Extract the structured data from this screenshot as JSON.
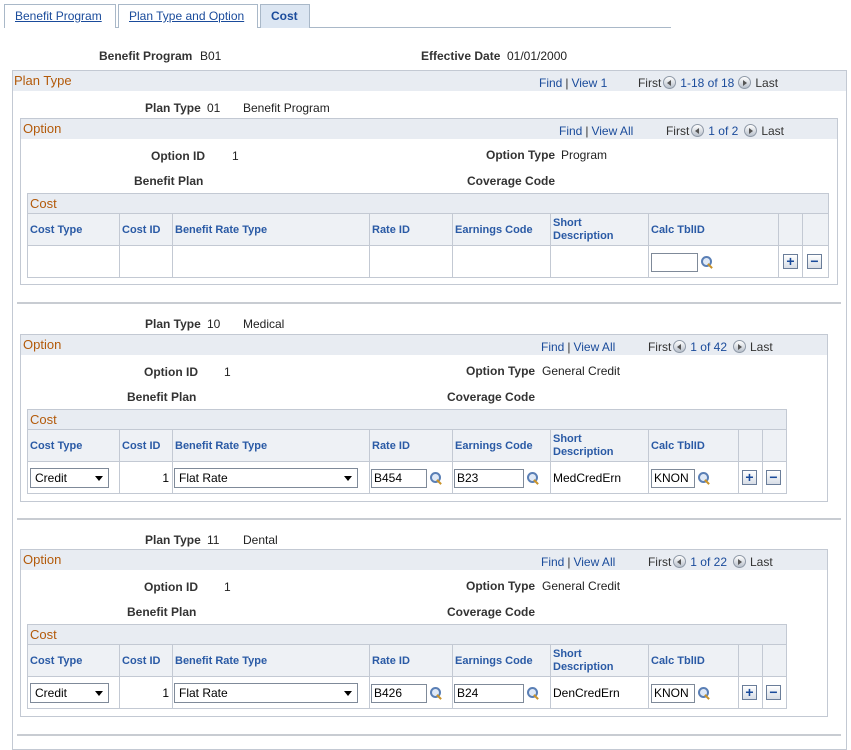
{
  "tabs": [
    {
      "label": "Benefit Program",
      "active": false
    },
    {
      "label": "Plan Type and Option",
      "active": false
    },
    {
      "label": "Cost",
      "active": true
    }
  ],
  "header": {
    "benefit_program_label": "Benefit Program",
    "benefit_program_value": "B01",
    "effective_date_label": "Effective Date",
    "effective_date_value": "01/01/2000"
  },
  "plan_type_box": {
    "title": "Plan Type",
    "find": "Find",
    "view": "View 1",
    "first": "First",
    "range": "1-18 of 18",
    "last": "Last"
  },
  "labels": {
    "plan_type": "Plan Type",
    "option_id": "Option ID",
    "option_type": "Option Type",
    "benefit_plan": "Benefit Plan",
    "coverage_code": "Coverage Code",
    "option_title": "Option",
    "cost_title": "Cost",
    "find": "Find",
    "view_all": "View All",
    "first": "First",
    "last": "Last"
  },
  "cost_columns": {
    "cost_type": "Cost Type",
    "cost_id": "Cost ID",
    "benefit_rate_type": "Benefit Rate Type",
    "rate_id": "Rate ID",
    "earnings_code": "Earnings Code",
    "short_description_1": "Short",
    "short_description_2": "Description",
    "calc_tblid": "Calc TblID"
  },
  "plans": [
    {
      "plan_type_code": "01",
      "plan_type_desc": "Benefit Program",
      "option_range": "1 of 2",
      "option_id": "1",
      "option_type": "Program",
      "cost_row": {
        "cost_type": "",
        "cost_id": "",
        "benefit_rate_type": "",
        "rate_id": "",
        "earnings_code": "",
        "short_description": "",
        "calc_tblid": ""
      }
    },
    {
      "plan_type_code": "10",
      "plan_type_desc": "Medical",
      "option_range": "1 of 42",
      "option_id": "1",
      "option_type": "General Credit",
      "cost_row": {
        "cost_type": "Credit",
        "cost_id": "1",
        "benefit_rate_type": "Flat Rate",
        "rate_id": "B454",
        "earnings_code": "B23",
        "short_description": "MedCredErn",
        "calc_tblid": "KNON"
      }
    },
    {
      "plan_type_code": "11",
      "plan_type_desc": "Dental",
      "option_range": "1 of 22",
      "option_id": "1",
      "option_type": "General Credit",
      "cost_row": {
        "cost_type": "Credit",
        "cost_id": "1",
        "benefit_rate_type": "Flat Rate",
        "rate_id": "B426",
        "earnings_code": "B24",
        "short_description": "DenCredErn",
        "calc_tblid": "KNON"
      }
    }
  ]
}
